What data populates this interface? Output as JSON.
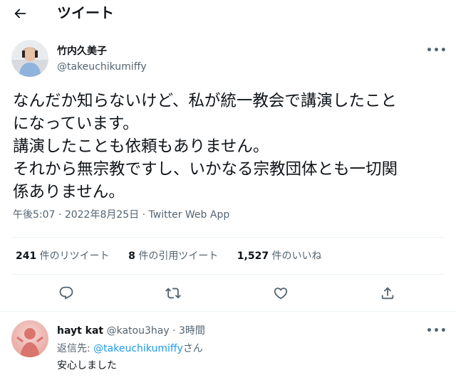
{
  "header": {
    "title": "ツイート"
  },
  "tweet": {
    "author_name": "竹内久美子",
    "author_handle": "@takeuchikumiffy",
    "text_lines": [
      "なんだか知らないけど、私が統一教会で講演したこと",
      "になっています。",
      "講演したことも依頼もありません。",
      "それから無宗教ですし、いかなる宗教団体とも一切関",
      "係ありません。"
    ],
    "time": "午後5:07",
    "date": "2022年8月25日",
    "separator": " · ",
    "source": "Twitter Web App",
    "more_label": "•••"
  },
  "stats": {
    "retweets": {
      "count": "241",
      "label": " 件のリツイート"
    },
    "quotes": {
      "count": "8",
      "label": " 件の引用ツイート"
    },
    "likes": {
      "count": "1,527",
      "label": " 件のいいね"
    }
  },
  "actions": [
    "reply-icon",
    "retweet-icon",
    "like-icon",
    "share-icon"
  ],
  "reply": {
    "name": "hayt kat",
    "handle": "@katou3hay",
    "separator": " · ",
    "time": "3時間",
    "reply_prefix": "返信先: ",
    "reply_mention": "@takeuchikumiffy",
    "reply_suffix": "さん",
    "text": "安心しました",
    "more_label": "•••"
  },
  "colors": {
    "text": "#0f1419",
    "secondary": "#536471",
    "link": "#1d9bf0",
    "divider": "#eff3f4"
  }
}
